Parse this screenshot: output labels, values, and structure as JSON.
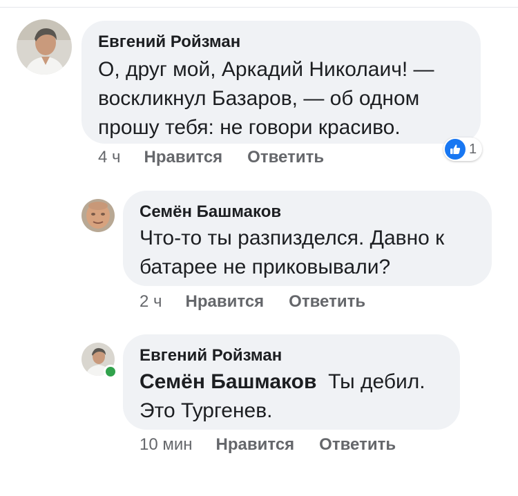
{
  "comments": [
    {
      "author": "Евгений Ройзман",
      "lines": [
        "О, друг мой, Аркадий Николаич! —",
        "воскликнул Базаров, — об одном",
        "прошу тебя: не говори красиво."
      ],
      "time": "4 ч",
      "like_label": "Нравится",
      "reply_label": "Ответить",
      "reaction": {
        "icon": "thumbs-up-icon",
        "count": "1",
        "color": "#1877f2"
      }
    },
    {
      "author": "Семён Башмаков",
      "lines": [
        "Что-то ты разпизделся. Давно к",
        "батарее не приковывали?"
      ],
      "time": "2 ч",
      "like_label": "Нравится",
      "reply_label": "Ответить"
    },
    {
      "author": "Евгений Ройзман",
      "mention": "Семён Башмаков",
      "lines": [
        "Ты дебил.",
        "Это Тургенев."
      ],
      "time": "10 мин",
      "like_label": "Нравится",
      "reply_label": "Ответить",
      "online_color": "#31a24c"
    }
  ]
}
